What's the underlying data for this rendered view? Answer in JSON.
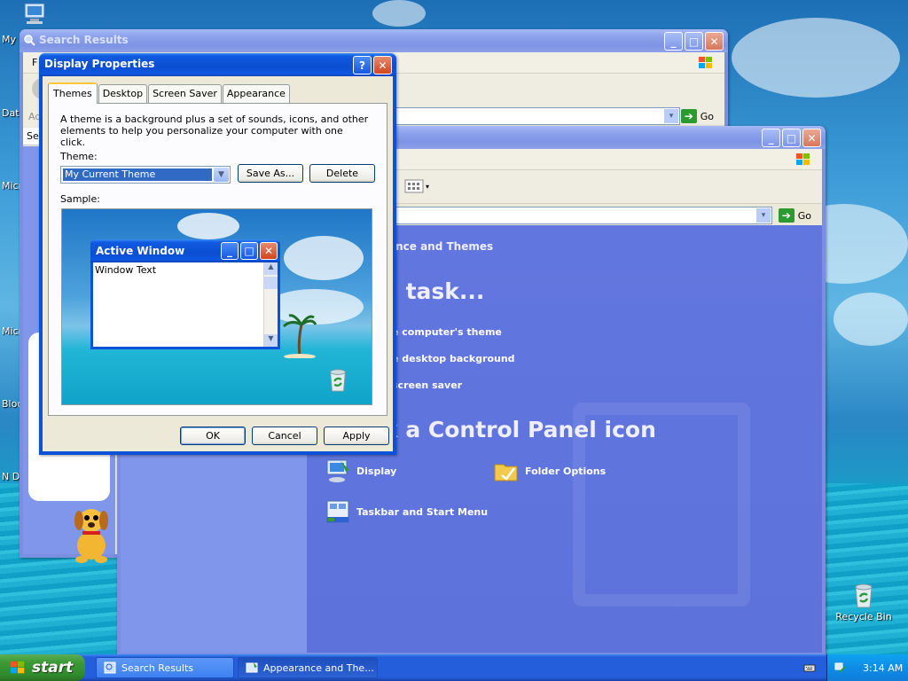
{
  "desktop": {
    "left_labels": [
      "My",
      "Dat",
      "Micro C",
      "Micro B",
      "Bloc",
      "N D"
    ],
    "recycle_bin_label": "Recycle Bin"
  },
  "search_window": {
    "title": "Search Results",
    "menu_partial": "F",
    "address_partial": "Ad",
    "search_partial": "Se",
    "go_label": "Go"
  },
  "control_panel": {
    "breadcrumb": "ance and Themes",
    "pick_task_heading": "a task...",
    "tasks": [
      "e computer's theme",
      "e desktop background",
      "screen saver"
    ],
    "pick_icon_heading": "k a Control Panel icon",
    "icons": [
      {
        "label": "Display",
        "icon": "display-icon"
      },
      {
        "label": "Folder Options",
        "icon": "folder-options-icon"
      },
      {
        "label": "Taskbar and Start Menu",
        "icon": "taskbar-icon"
      }
    ],
    "go_label": "Go"
  },
  "display_dialog": {
    "title": "Display Properties",
    "tabs": [
      "Themes",
      "Desktop",
      "Screen Saver",
      "Appearance"
    ],
    "active_tab": "Themes",
    "description": "A theme is a background plus a set of sounds, icons, and other elements to help you personalize your computer with one click.",
    "theme_label": "Theme:",
    "theme_value": "My Current Theme",
    "save_as_label": "Save As...",
    "delete_label": "Delete",
    "sample_label": "Sample:",
    "sample_window_title": "Active Window",
    "sample_window_text": "Window Text",
    "ok_label": "OK",
    "cancel_label": "Cancel",
    "apply_label": "Apply"
  },
  "taskbar": {
    "start_label": "start",
    "tasks": [
      {
        "label": "Search Results",
        "active": false
      },
      {
        "label": "Appearance and The...",
        "active": true
      }
    ],
    "clock": "3:14 AM"
  },
  "colors": {
    "accent": "#0c52d8",
    "taskbar": "#245edb",
    "start_green": "#3c9a35"
  }
}
